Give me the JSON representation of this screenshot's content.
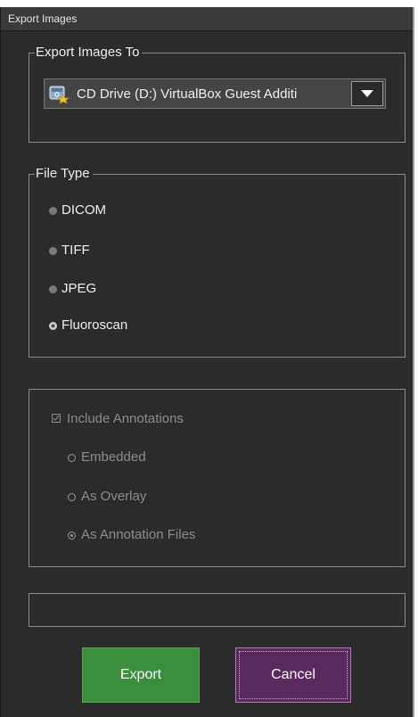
{
  "window": {
    "title": "Export Images"
  },
  "export_to": {
    "legend": "Export Images To",
    "selected_drive": "CD Drive (D:) VirtualBox Guest Additi"
  },
  "file_type": {
    "legend": "File Type",
    "options": [
      {
        "label": "DICOM",
        "selected": false
      },
      {
        "label": "TIFF",
        "selected": false
      },
      {
        "label": "JPEG",
        "selected": false
      },
      {
        "label": "Fluoroscan",
        "selected": true
      }
    ]
  },
  "annotations": {
    "enabled": false,
    "include_label": "Include Annotations",
    "include_checked": true,
    "options": [
      {
        "label": "Embedded",
        "selected": false
      },
      {
        "label": "As Overlay",
        "selected": false
      },
      {
        "label": "As Annotation Files",
        "selected": true
      }
    ]
  },
  "status": {
    "text": ""
  },
  "buttons": {
    "export_label": "Export",
    "cancel_label": "Cancel"
  },
  "icons": {
    "drive": "cd-drive-icon",
    "dropdown": "chevron-down-icon"
  },
  "colors": {
    "export_button": "#3a8f3e",
    "cancel_button": "#5a2a5e",
    "background": "#2b2b2b"
  }
}
